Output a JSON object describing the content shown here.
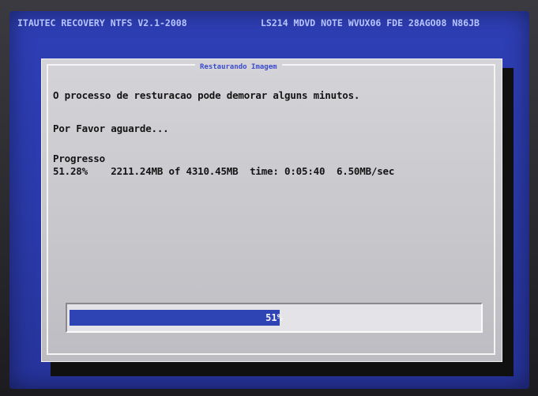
{
  "header": {
    "left_text": "ITAUTEC RECOVERY NTFS V2.1-2008",
    "right_text": "LS214 MDVD NOTE WVUX06 FDE 28AGO08 N86JB"
  },
  "dialog": {
    "title": "Restaurando Imagem",
    "message": "O processo de resturacao pode demorar alguns minutos.",
    "wait_text": "Por Favor aguarde...",
    "progress_heading": "Progresso",
    "progress_line": "51.28%    2211.24MB of 4310.45MB  time: 0:05:40  6.50MB/sec",
    "progress": {
      "fraction": 0.5128,
      "label": "51%"
    }
  },
  "colors": {
    "screen_blue": "#2e3fb6",
    "dialog_gray": "#d4d4d8",
    "progress_blue": "#2e43b4",
    "text_dark": "#141414"
  }
}
